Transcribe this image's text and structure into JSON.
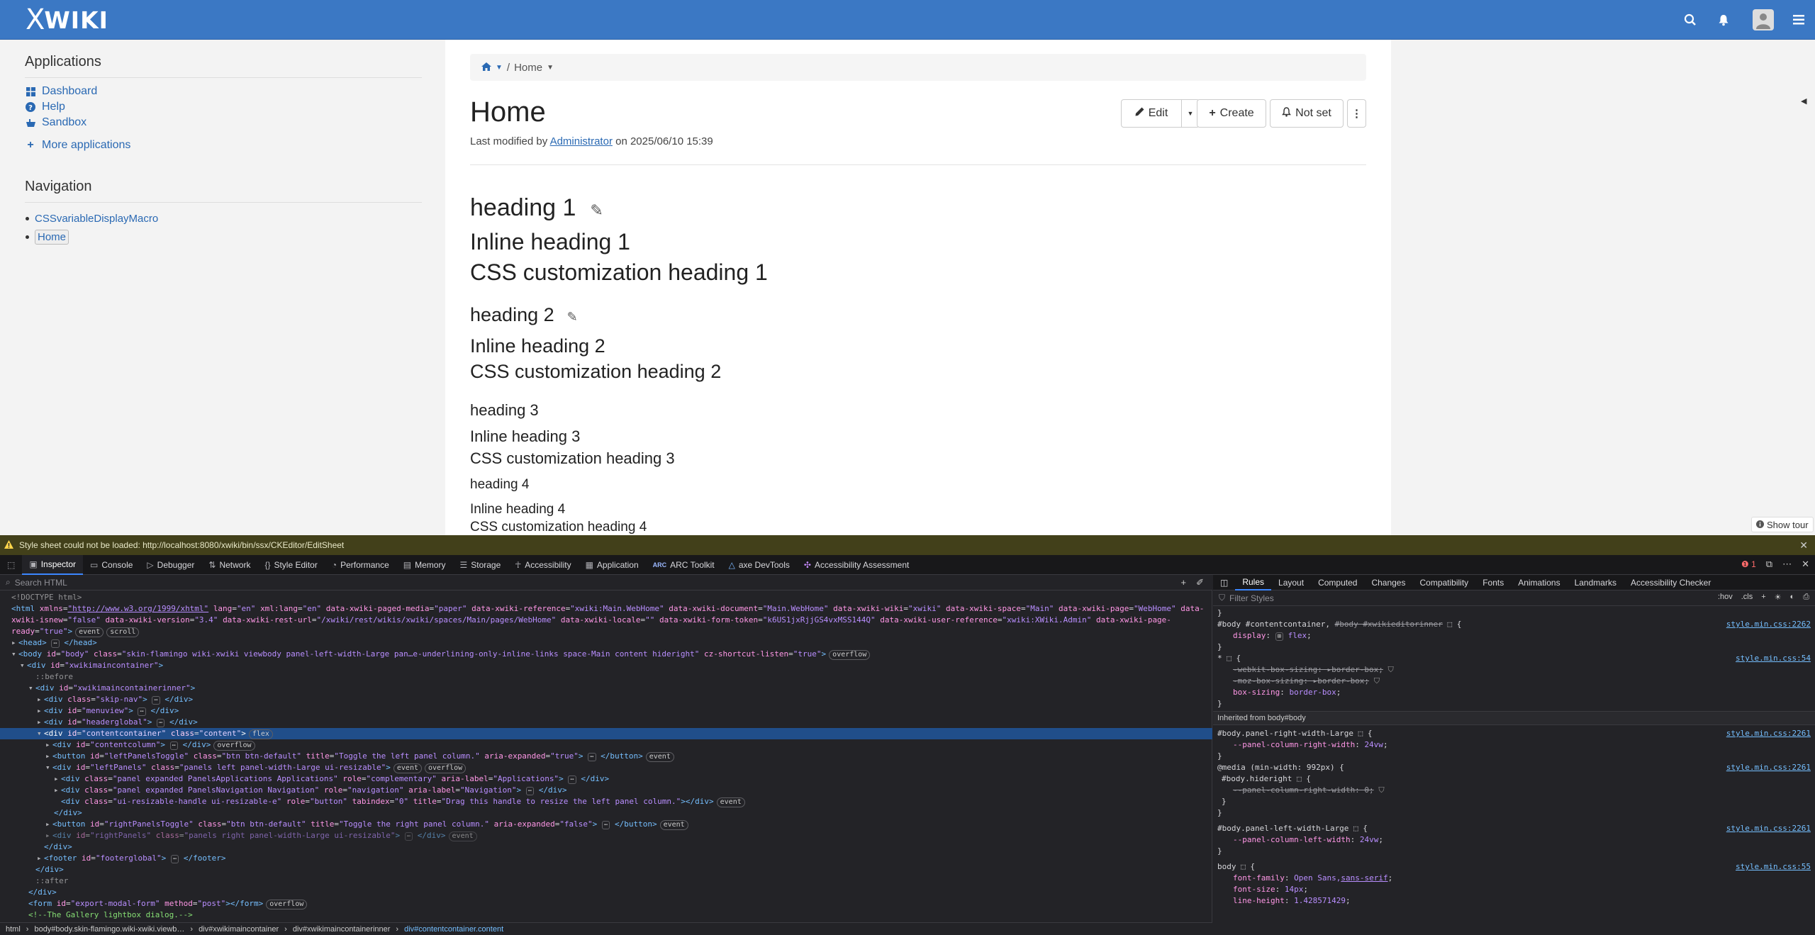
{
  "topbar": {
    "logo": "WIKI",
    "logo_x": "X"
  },
  "left_panel": {
    "applications_title": "Applications",
    "applications": [
      {
        "label": "Dashboard",
        "icon": "dashboard-icon"
      },
      {
        "label": "Help",
        "icon": "help-icon"
      },
      {
        "label": "Sandbox",
        "icon": "sandbox-icon"
      },
      {
        "label": "More applications",
        "icon": "plus-icon"
      }
    ],
    "navigation_title": "Navigation",
    "navigation": [
      "CSSvariableDisplayMacro",
      "Home"
    ]
  },
  "content": {
    "breadcrumb": {
      "separator": "/",
      "current": "Home"
    },
    "title": "Home",
    "last_modified": {
      "prefix": "Last modified by",
      "user": "Administrator",
      "date": "on 2025/06/10 15:39"
    },
    "buttons": {
      "edit": "Edit",
      "create": "Create",
      "notify": "Not set"
    },
    "headings": {
      "h1": "heading 1",
      "h1_inline": "Inline heading 1",
      "h1_css": "CSS customization heading 1",
      "h2": "heading 2",
      "h2_inline": "Inline heading 2",
      "h2_css": "CSS customization heading 2",
      "h3": "heading 3",
      "h3_inline": "Inline heading 3",
      "h3_css": "CSS customization heading 3",
      "h4": "heading 4",
      "h4_inline": "Inline heading 4",
      "h4_css": "CSS customization heading 4"
    },
    "show_tour": "Show tour"
  },
  "devtools": {
    "warning": "Style sheet could not be loaded: http://localhost:8080/xwiki/bin/ssx/CKEditor/EditSheet",
    "tabs": [
      "Inspector",
      "Console",
      "Debugger",
      "Network",
      "Style Editor",
      "Performance",
      "Memory",
      "Storage",
      "Accessibility",
      "Application",
      "ARC Toolkit",
      "axe DevTools",
      "Accessibility Assessment"
    ],
    "error_count": "1",
    "search_placeholder": "Search HTML",
    "breadcrumbs": [
      "html",
      "body#body.skin-flamingo.wiki-xwiki.viewb…",
      "div#xwikimaincontainer",
      "div#xwikimaincontainerinner",
      "div#contentcontainer.content"
    ],
    "rule_tabs": [
      "Rules",
      "Layout",
      "Computed",
      "Changes",
      "Compatibility",
      "Fonts",
      "Animations",
      "Landmarks",
      "Accessibility Checker"
    ],
    "filter_placeholder": "Filter Styles",
    "filter_buttons": [
      ":hov",
      ".cls"
    ],
    "inherited_label": "Inherited from body#body"
  }
}
